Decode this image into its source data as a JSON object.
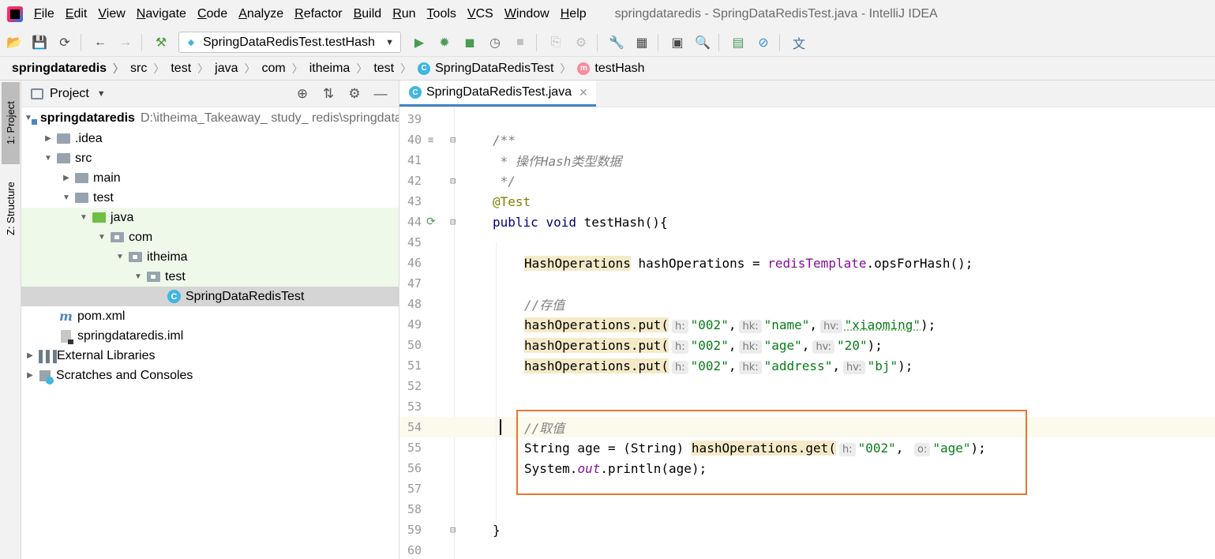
{
  "menubar": {
    "items": [
      "File",
      "Edit",
      "View",
      "Navigate",
      "Code",
      "Analyze",
      "Refactor",
      "Build",
      "Run",
      "Tools",
      "VCS",
      "Window",
      "Help"
    ],
    "window_title": "springdataredis - SpringDataRedisTest.java - IntelliJ IDEA"
  },
  "toolbar": {
    "run_config": "SpringDataRedisTest.testHash"
  },
  "breadcrumb": {
    "items": [
      "springdataredis",
      "src",
      "test",
      "java",
      "com",
      "itheima",
      "test",
      "SpringDataRedisTest",
      "testHash"
    ]
  },
  "tool_strip": {
    "project_tab": "1: Project",
    "structure_tab": "Z: Structure"
  },
  "project": {
    "header_label": "Project",
    "tree": [
      {
        "label": "springdataredis",
        "path": "D:\\itheima_Takeaway_ study_ redis\\springdataredis"
      },
      {
        "label": ".idea"
      },
      {
        "label": "src"
      },
      {
        "label": "main"
      },
      {
        "label": "test"
      },
      {
        "label": "java"
      },
      {
        "label": "com"
      },
      {
        "label": "itheima"
      },
      {
        "label": "test"
      },
      {
        "label": "SpringDataRedisTest"
      },
      {
        "label": "pom.xml"
      },
      {
        "label": "springdataredis.iml"
      },
      {
        "label": "External Libraries"
      },
      {
        "label": "Scratches and Consoles"
      }
    ]
  },
  "editor": {
    "tab_label": "SpringDataRedisTest.java",
    "line_numbers": [
      "39",
      "40",
      "41",
      "42",
      "43",
      "44",
      "45",
      "46",
      "47",
      "48",
      "49",
      "50",
      "51",
      "52",
      "53",
      "54",
      "55",
      "56",
      "57",
      "58",
      "59",
      "60"
    ],
    "code": {
      "l40": "/**",
      "l41": " * 操作Hash类型数据",
      "l42": " */",
      "l43": "@Test",
      "l44_kw1": "public",
      "l44_kw2": "void",
      "l44_rest": "testHash(){",
      "l46_type": "HashOperations",
      "l46_mid": " hashOperations = ",
      "l46_field": "redisTemplate",
      "l46_end": ".opsForHash();",
      "l48": "//存值",
      "call_put": "hashOperations.put(",
      "hint_h": "h:",
      "hint_hk": "hk:",
      "hint_hv": "hv:",
      "hint_o": "o:",
      "key": "\"002\"",
      "comma": ",",
      "l49_hk": "\"name\"",
      "l49_hv": "\"xiaoming\"",
      "l50_hk": "\"age\"",
      "l50_hv": "\"20\"",
      "l51_hk": "\"address\"",
      "l51_hv": "\"bj\"",
      "close": ");",
      "l54": "//取值",
      "l55_pre": "String age = (String) ",
      "l55_call": "hashOperations.get(",
      "l55_o": "\"age\"",
      "l56_pre": "System.",
      "l56_static": "out",
      "l56_end": ".println(age);",
      "l59": "}"
    }
  }
}
